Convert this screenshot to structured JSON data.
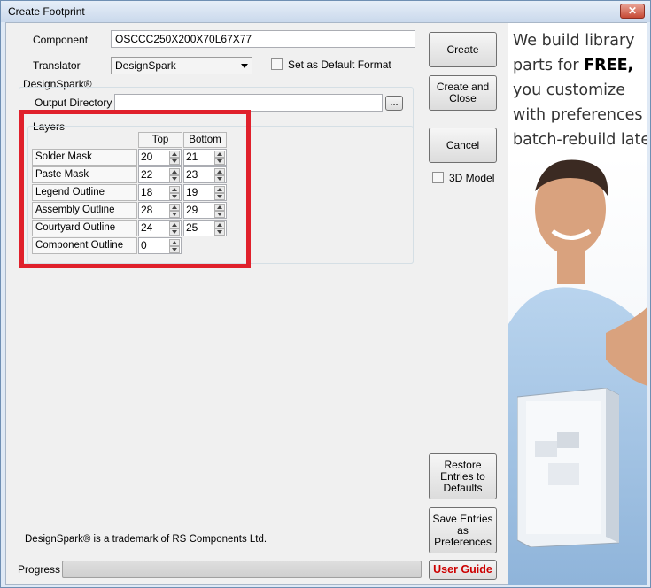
{
  "window": {
    "title": "Create Footprint",
    "close_label": "✕"
  },
  "component": {
    "label": "Component",
    "value": "OSCCC250X200X70L67X77"
  },
  "translator": {
    "label": "Translator",
    "selected": "DesignSpark"
  },
  "default_format": {
    "label": "Set as Default Format",
    "checked": false
  },
  "designspark_group": {
    "label": "DesignSpark®"
  },
  "output_directory": {
    "label": "Output Directory",
    "value": "",
    "browse_label": "..."
  },
  "layers": {
    "label": "Layers",
    "col_top": "Top",
    "col_bottom": "Bottom",
    "rows": [
      {
        "name": "Solder Mask",
        "top": "20",
        "bottom": "21"
      },
      {
        "name": "Paste Mask",
        "top": "22",
        "bottom": "23"
      },
      {
        "name": "Legend Outline",
        "top": "18",
        "bottom": "19"
      },
      {
        "name": "Assembly Outline",
        "top": "28",
        "bottom": "29"
      },
      {
        "name": "Courtyard Outline",
        "top": "24",
        "bottom": "25"
      },
      {
        "name": "Component Outline",
        "top": "0",
        "bottom": ""
      }
    ]
  },
  "buttons": {
    "create": "Create",
    "create_close": "Create and Close",
    "cancel": "Cancel",
    "restore_defaults": "Restore Entries to Defaults",
    "save_preferences": "Save Entries as Preferences",
    "user_guide": "User Guide"
  },
  "model_3d": {
    "label": "3D Model",
    "checked": false
  },
  "trademark": "DesignSpark® is a trademark of RS Components Ltd.",
  "progress": {
    "label": "Progress",
    "fraction": 0
  },
  "ad": {
    "line1": "We build library",
    "line2a": "parts for ",
    "line2b": "FREE,",
    "line3": "you customize",
    "line4": "with preferences &",
    "line5": "batch-rebuild later!"
  },
  "colors": {
    "highlight": "#e0202b",
    "user_guide_text": "#cc0000"
  }
}
